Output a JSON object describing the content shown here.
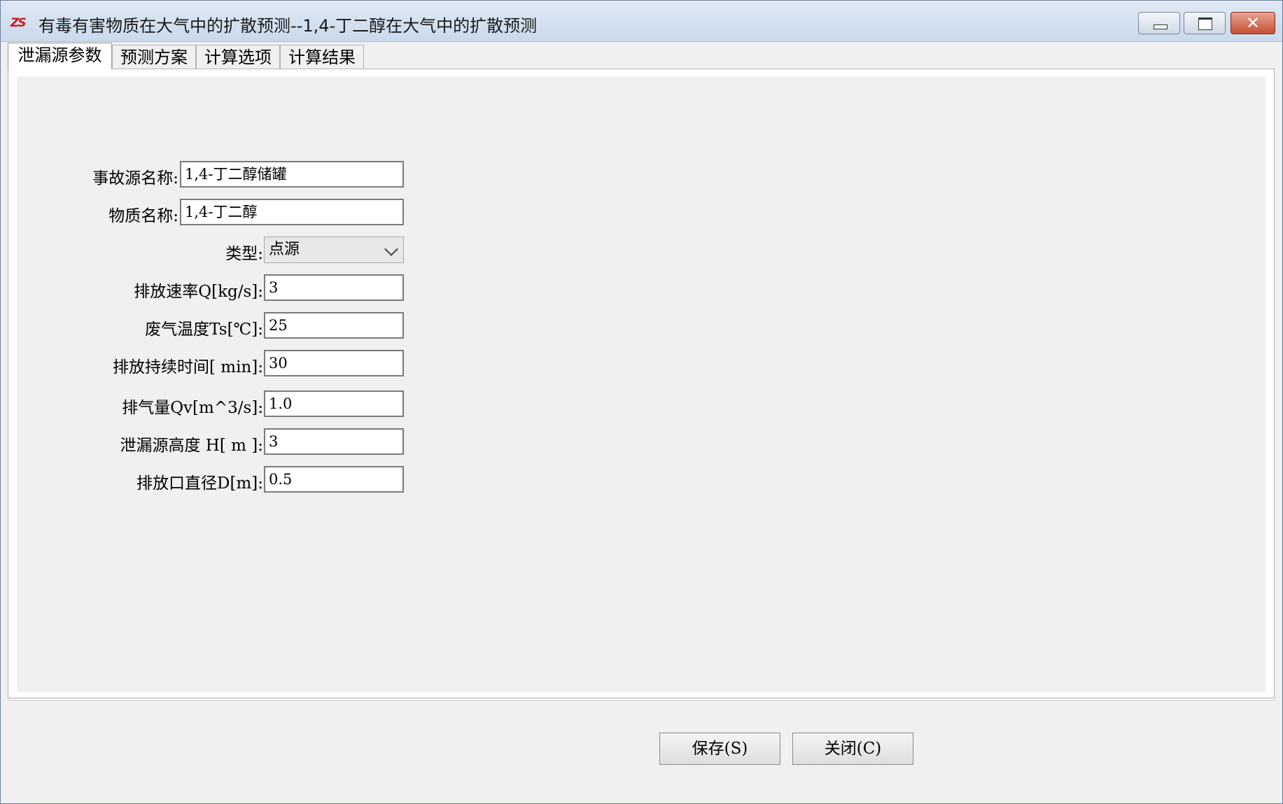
{
  "window": {
    "title": "有毒有害物质在大气中的扩散预测--1,4-丁二醇在大气中的扩散预测",
    "app_icon_text": "ZS",
    "controls": {
      "minimize": "minimize-icon",
      "maximize": "maximize-icon",
      "close": "✕"
    }
  },
  "tabs": [
    {
      "label": "泄漏源参数",
      "active": true
    },
    {
      "label": "预测方案",
      "active": false
    },
    {
      "label": "计算选项",
      "active": false
    },
    {
      "label": "计算结果",
      "active": false
    }
  ],
  "form": {
    "source_name": {
      "label": "事故源名称:",
      "value": "1,4-丁二醇储罐"
    },
    "material_name": {
      "label": "物质名称:",
      "value": "1,4-丁二醇"
    },
    "type": {
      "label": "类型:",
      "value": "点源"
    },
    "release_rate": {
      "label": "排放速率Q[kg/s]:",
      "value": "3"
    },
    "gas_temp": {
      "label": "废气温度Ts[℃]:",
      "value": "25"
    },
    "duration": {
      "label": "排放持续时间[ min]:",
      "value": "30"
    },
    "exhaust_volume": {
      "label": "排气量Qv[m^3/s]:",
      "value": "1.0"
    },
    "height": {
      "label": "泄漏源高度 H[  m ]:",
      "value": "3"
    },
    "outlet_diameter": {
      "label": "排放口直径D[m]:",
      "value": "0.5"
    }
  },
  "buttons": {
    "save": "保存(S)",
    "close": "关闭(C)"
  }
}
